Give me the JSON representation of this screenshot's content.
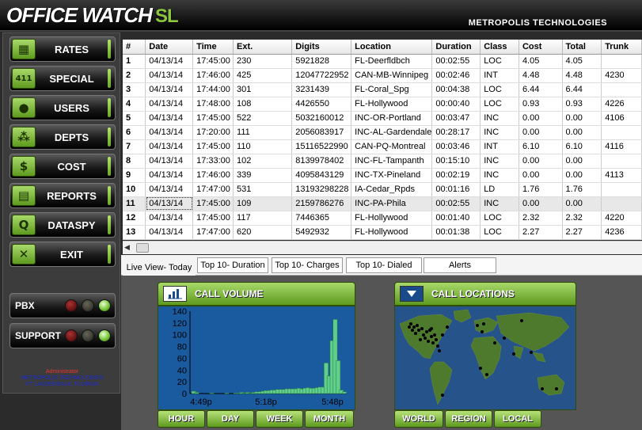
{
  "app": {
    "logo_text": "OFFICE WATCH",
    "logo_suffix": "SL",
    "company": "METROPOLIS TECHNOLOGIES"
  },
  "sidebar": {
    "items": [
      {
        "label": "RATES",
        "icon": "calculator-icon",
        "glyph": "▦"
      },
      {
        "label": "SPECIAL",
        "icon": "411-icon",
        "glyph": "411"
      },
      {
        "label": "USERS",
        "icon": "user-icon",
        "glyph": "●"
      },
      {
        "label": "DEPTS",
        "icon": "org-chart-icon",
        "glyph": "⁂"
      },
      {
        "label": "COST",
        "icon": "dollar-icon",
        "glyph": "$"
      },
      {
        "label": "REPORTS",
        "icon": "reports-icon",
        "glyph": "▤"
      },
      {
        "label": "DATASPY",
        "icon": "magnifier-icon",
        "glyph": "Q"
      },
      {
        "label": "EXIT",
        "icon": "exit-icon",
        "glyph": "✕"
      }
    ],
    "status": [
      {
        "label": "PBX",
        "lights": [
          "red",
          "amber",
          "green"
        ]
      },
      {
        "label": "SUPPORT",
        "lights": [
          "red",
          "amber",
          "green"
        ]
      }
    ],
    "admin": {
      "role": "Administrator",
      "line1": "METROPOLIS TECHNOLOGIES",
      "line2": "FT LAUDERDALE, FLORIDA"
    }
  },
  "table": {
    "columns": [
      "#",
      "Date",
      "Time",
      "Ext.",
      "Digits",
      "Location",
      "Duration",
      "Class",
      "Cost",
      "Total",
      "Trunk"
    ],
    "rows": [
      [
        "1",
        "04/13/14",
        "17:45:00",
        "230",
        "5921828",
        "FL-Deerfldbch",
        "00:02:55",
        "LOC",
        "4.05",
        "4.05",
        ""
      ],
      [
        "2",
        "04/13/14",
        "17:46:00",
        "425",
        "12047722952",
        "CAN-MB-Winnipeg",
        "00:02:46",
        "INT",
        "4.48",
        "4.48",
        "4230"
      ],
      [
        "3",
        "04/13/14",
        "17:44:00",
        "301",
        "3231439",
        "FL-Coral_Spg",
        "00:04:38",
        "LOC",
        "6.44",
        "6.44",
        ""
      ],
      [
        "4",
        "04/13/14",
        "17:48:00",
        "108",
        "4426550",
        "FL-Hollywood",
        "00:00:40",
        "LOC",
        "0.93",
        "0.93",
        "4226"
      ],
      [
        "5",
        "04/13/14",
        "17:45:00",
        "522",
        "5032160012",
        "INC-OR-Portland",
        "00:03:47",
        "INC",
        "0.00",
        "0.00",
        "4106"
      ],
      [
        "6",
        "04/13/14",
        "17:20:00",
        "111",
        "2056083917",
        "INC-AL-Gardendale",
        "00:28:17",
        "INC",
        "0.00",
        "0.00",
        ""
      ],
      [
        "7",
        "04/13/14",
        "17:45:00",
        "110",
        "15116522990",
        "CAN-PQ-Montreal",
        "00:03:46",
        "INT",
        "6.10",
        "6.10",
        "4116"
      ],
      [
        "8",
        "04/13/14",
        "17:33:00",
        "102",
        "8139978402",
        "INC-FL-Tampanth",
        "00:15:10",
        "INC",
        "0.00",
        "0.00",
        ""
      ],
      [
        "9",
        "04/13/14",
        "17:46:00",
        "339",
        "4095843129",
        "INC-TX-Pineland",
        "00:02:19",
        "INC",
        "0.00",
        "0.00",
        "4113"
      ],
      [
        "10",
        "04/13/14",
        "17:47:00",
        "531",
        "13193298228",
        "IA-Cedar_Rpds",
        "00:01:16",
        "LD",
        "1.76",
        "1.76",
        ""
      ],
      [
        "11",
        "04/13/14",
        "17:45:00",
        "109",
        "2159786276",
        "INC-PA-Phila",
        "00:02:55",
        "INC",
        "0.00",
        "0.00",
        ""
      ],
      [
        "12",
        "04/13/14",
        "17:45:00",
        "117",
        "7446365",
        "FL-Hollywood",
        "00:01:40",
        "LOC",
        "2.32",
        "2.32",
        "4220"
      ],
      [
        "13",
        "04/13/14",
        "17:47:00",
        "620",
        "5492932",
        "FL-Hollywood",
        "00:01:38",
        "LOC",
        "2.27",
        "2.27",
        "4236"
      ]
    ],
    "selected_row": 11
  },
  "tabs": [
    "Live View- Today",
    "Top 10- Duration",
    "Top 10- Charges",
    "Top 10- Dialed",
    "Alerts"
  ],
  "call_volume": {
    "title": "CALL VOLUME",
    "icon": "bar-chart-icon",
    "buttons": [
      "HOUR",
      "DAY",
      "WEEK",
      "MONTH"
    ]
  },
  "call_locations": {
    "title": "CALL LOCATIONS",
    "icon": "dropdown-arrow-icon",
    "buttons": [
      "WORLD",
      "REGION",
      "LOCAL"
    ]
  },
  "chart_data": {
    "type": "bar",
    "title": "",
    "ylim": [
      0,
      140
    ],
    "yticks": [
      0,
      20,
      40,
      60,
      80,
      100,
      120,
      140
    ],
    "xticks": [
      "4:49p",
      "5:18p",
      "5:48p"
    ],
    "values": [
      4,
      2,
      0,
      0,
      0,
      0,
      1,
      0,
      0,
      0,
      0,
      1,
      0,
      0,
      1,
      1,
      2,
      1,
      2,
      1,
      2,
      3,
      3,
      4,
      5,
      5,
      6,
      6,
      7,
      7,
      7,
      8,
      8,
      8,
      8,
      9,
      8,
      9,
      10,
      9,
      9,
      10,
      11,
      11,
      52,
      30,
      90,
      126,
      56,
      6,
      3
    ],
    "colors": {
      "bar": "#5fcf8a",
      "bar_edge": "#2a7a4a",
      "background": "#1a5a9e"
    }
  }
}
